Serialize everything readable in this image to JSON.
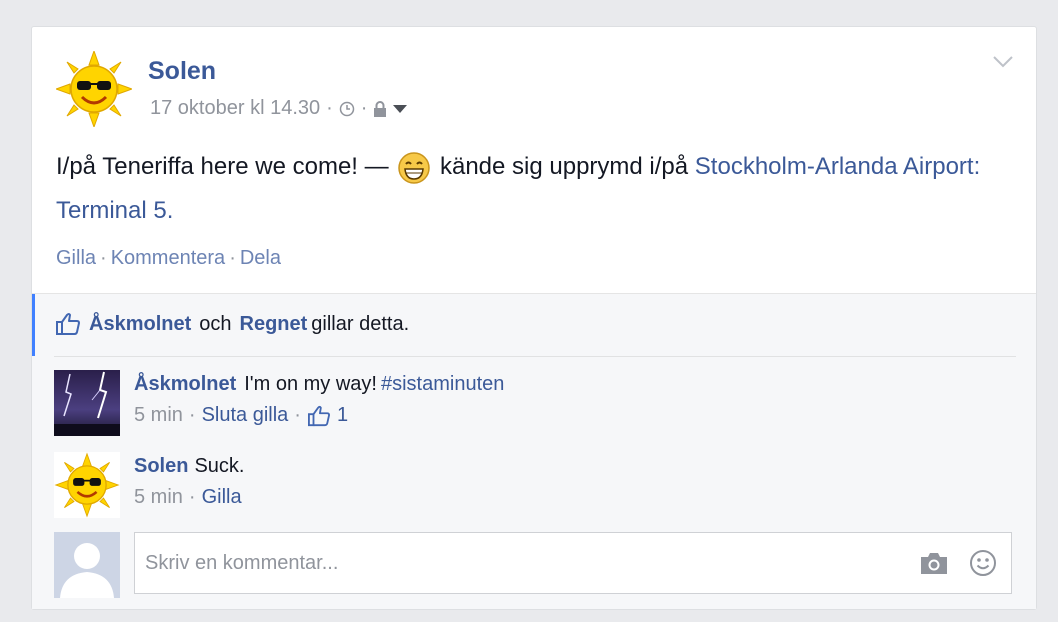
{
  "post": {
    "author": "Solen",
    "timestamp": "17 oktober kl 14.30",
    "text_prefix": "I/på  Teneriffa here we come! —",
    "feeling": "kände sig upprymd i/på",
    "location": "Stockholm-Arlanda Airport: Terminal 5.",
    "actions": {
      "like": "Gilla",
      "comment": "Kommentera",
      "share": "Dela",
      "sep": "·"
    }
  },
  "likes": {
    "user1": "Åskmolnet",
    "conj": "och",
    "user2": "Regnet",
    "suffix": "gillar detta."
  },
  "comments": [
    {
      "author": "Åskmolnet",
      "text": "I'm on my way!",
      "hashtag": "#sistaminuten",
      "time": "5 min",
      "action": "Sluta gilla",
      "like_count": "1"
    },
    {
      "author": "Solen",
      "text": "Suck.",
      "time": "5 min",
      "action": "Gilla"
    }
  ],
  "composer": {
    "placeholder": "Skriv en kommentar..."
  }
}
